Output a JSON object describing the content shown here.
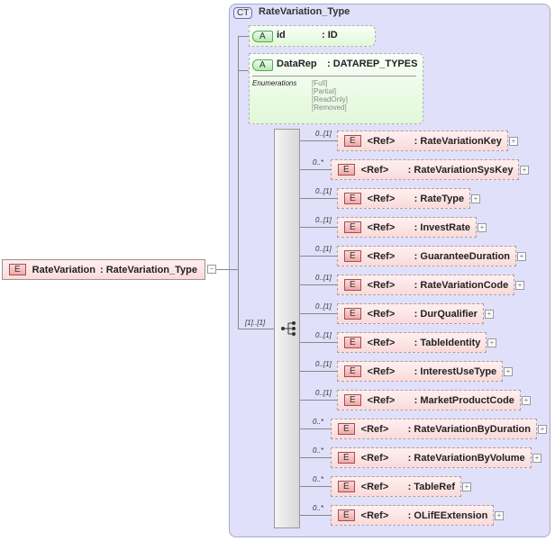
{
  "root": {
    "badge": "E",
    "name": "RateVariation",
    "type": ": RateVariation_Type",
    "toggle": "−"
  },
  "complex_type": {
    "badge": "CT",
    "name": "RateVariation_Type"
  },
  "attributes": [
    {
      "badge": "A",
      "name": "id",
      "type": ": ID"
    },
    {
      "badge": "A",
      "name": "DataRep",
      "type": ": DATAREP_TYPES",
      "enum_label": "Enumerations",
      "enums": [
        "[Full]",
        "[Partial]",
        "[ReadOnly]",
        "[Removed]"
      ]
    }
  ],
  "sequence": {
    "cardinality": "[1]..[1]",
    "icon": "sequence-icon"
  },
  "children": [
    {
      "card": "0..[1]",
      "ref": "<Ref>",
      "type": ": RateVariationKey"
    },
    {
      "card": "0..*",
      "ref": "<Ref>",
      "type": ": RateVariationSysKey"
    },
    {
      "card": "0..[1]",
      "ref": "<Ref>",
      "type": ": RateType"
    },
    {
      "card": "0..[1]",
      "ref": "<Ref>",
      "type": ": InvestRate"
    },
    {
      "card": "0..[1]",
      "ref": "<Ref>",
      "type": ": GuaranteeDuration"
    },
    {
      "card": "0..[1]",
      "ref": "<Ref>",
      "type": ": RateVariationCode"
    },
    {
      "card": "0..[1]",
      "ref": "<Ref>",
      "type": ": DurQualifier"
    },
    {
      "card": "0..[1]",
      "ref": "<Ref>",
      "type": ": TableIdentity"
    },
    {
      "card": "0..[1]",
      "ref": "<Ref>",
      "type": ": InterestUseType"
    },
    {
      "card": "0..[1]",
      "ref": "<Ref>",
      "type": ": MarketProductCode"
    },
    {
      "card": "0..*",
      "ref": "<Ref>",
      "type": ": RateVariationByDuration"
    },
    {
      "card": "0..*",
      "ref": "<Ref>",
      "type": ": RateVariationByVolume"
    },
    {
      "card": "0..*",
      "ref": "<Ref>",
      "type": ": TableRef"
    },
    {
      "card": "0..*",
      "ref": "<Ref>",
      "type": ": OLifEExtension"
    }
  ],
  "badge_e": "E",
  "plus": "+"
}
